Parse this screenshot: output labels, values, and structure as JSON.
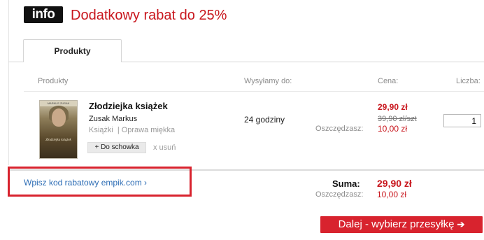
{
  "header": {
    "badge": "info",
    "promo": "Dodatkowy rabat do 25%"
  },
  "tabs": [
    {
      "label": "Produkty",
      "active": true
    }
  ],
  "columns": {
    "products": "Produkty",
    "shipping": "Wysyłamy do:",
    "price": "Cena:",
    "quantity": "Liczba:"
  },
  "item": {
    "title": "Złodziejka książek",
    "author": "Zusak Markus",
    "category": "Książki",
    "binding": "Oprawa miękka",
    "stash_label": "+ Do schowka",
    "remove_label": "x usuń",
    "shipping_time": "24 godziny",
    "price": "29,90 zł",
    "old_price": "39,90 zł",
    "old_price_unit": "/szt",
    "savings_label": "Oszczędzasz:",
    "savings": "10,00 zł",
    "quantity": "1",
    "cover_author": "MARKUS ZUSAK",
    "cover_title": "Złodziejka książek"
  },
  "coupon": {
    "link": "Wpisz kod rabatowy empik.com ›"
  },
  "totals": {
    "sum_label": "Suma:",
    "sum": "29,90 zł",
    "savings_label": "Oszczędzasz:",
    "savings": "10,00 zł"
  },
  "actions": {
    "next_label": "Dalej - wybierz przesyłkę",
    "next_arrow": "➔"
  },
  "colors": {
    "accent": "#d8232e",
    "price": "#c8161d",
    "link": "#2d6db5"
  }
}
